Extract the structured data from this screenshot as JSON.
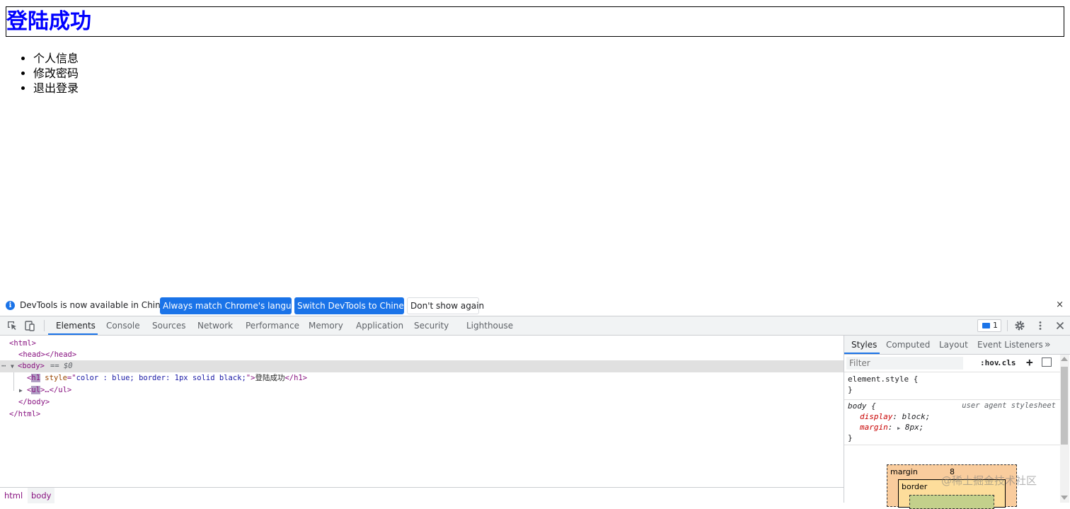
{
  "page": {
    "heading": "登陆成功",
    "list_items": [
      "个人信息",
      "修改密码",
      "退出登录"
    ]
  },
  "infobar": {
    "message": "DevTools is now available in Chinese!",
    "btn_always_match": "Always match Chrome's language",
    "btn_switch": "Switch DevTools to Chinese",
    "btn_dont_show": "Don't show again",
    "close_glyph": "×"
  },
  "devtools": {
    "tabs": [
      "Elements",
      "Console",
      "Sources",
      "Network",
      "Performance",
      "Memory",
      "Application",
      "Security",
      "Lighthouse"
    ],
    "active_tab": "Elements",
    "issues_count": "1",
    "elements": {
      "line1": "<html>",
      "line2_open": "<head>",
      "line2_close": "</head>",
      "line3_tag": "<body>",
      "line3_marker": "== $0",
      "line4_h1_open_pre": "<",
      "line4_tag_h1": "h1",
      "line4_attr_name": " style",
      "line4_attr_eq": "=\"",
      "line4_attr_value": "color : blue; border: 1px solid black;",
      "line4_attr_end": "\">",
      "line4_text": "登陆成功",
      "line4_close": "</h1>",
      "line5_pre": "<",
      "line5_tag_ul": "ul",
      "line5_rest": ">…</ul>",
      "line6": "</body>",
      "line7": "</html>"
    },
    "breadcrumbs": [
      "html",
      "body"
    ],
    "styles": {
      "tabs": [
        "Styles",
        "Computed",
        "Layout",
        "Event Listeners"
      ],
      "more_glyph": "»",
      "filter_placeholder": "Filter",
      "hov": ":hov",
      "cls": ".cls",
      "add_glyph": "+",
      "rule_element_selector": "element.style {",
      "rule_close": "}",
      "rule_body_selector": "body {",
      "rule_body_origin": "user agent stylesheet",
      "prop1_name": "display",
      "prop1_value": "block;",
      "prop2_name": "margin",
      "prop2_value": "8px;",
      "box_margin_label": "margin",
      "box_margin_value": "8",
      "box_border_label": "border"
    }
  },
  "watermark": "@稀土掘金技术社区",
  "colors": {
    "accent": "#1a73e8",
    "heading": "#0000ff",
    "tag": "#881280",
    "attr_name": "#994500",
    "attr_value": "#1a1aa6"
  }
}
